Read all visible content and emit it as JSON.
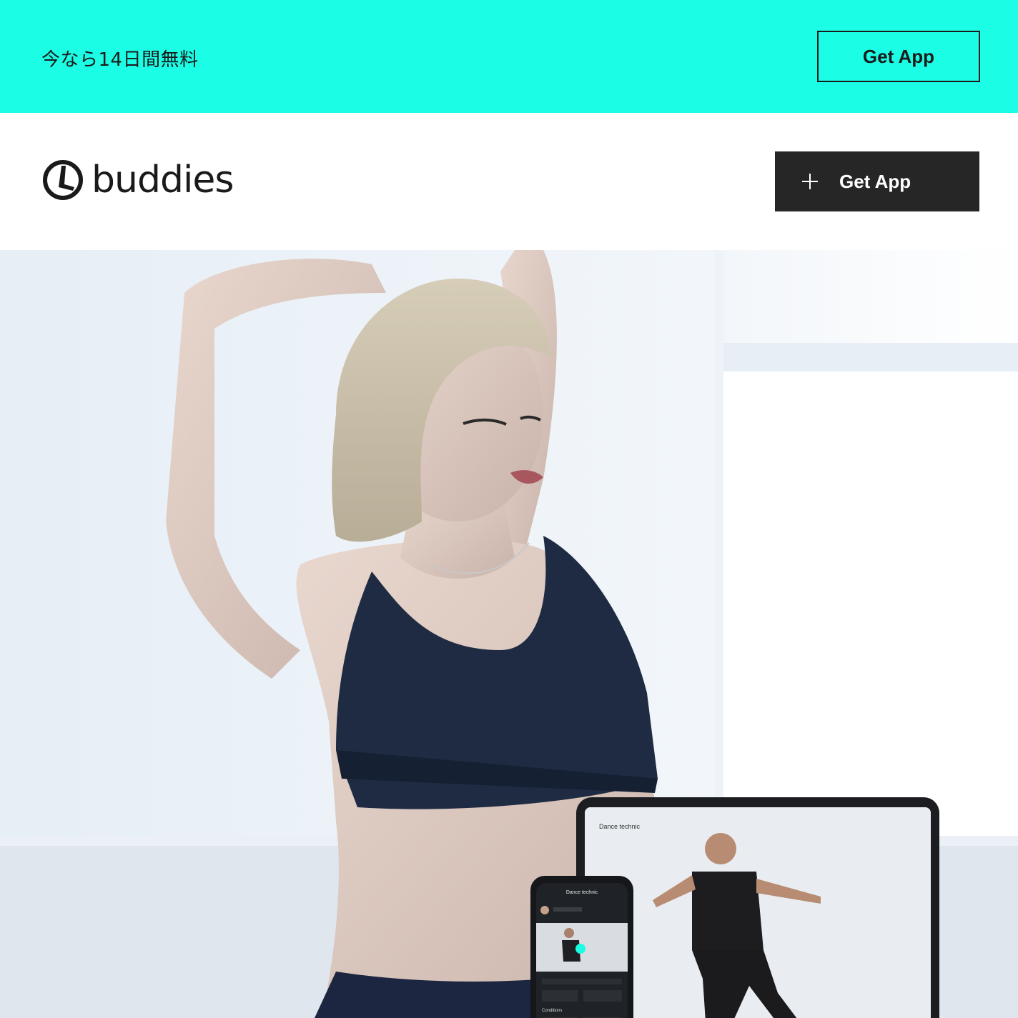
{
  "promo": {
    "text": "今なら14日間無料",
    "button_label": "Get App"
  },
  "header": {
    "logo_text": "buddies",
    "button_label": "Get App"
  },
  "hero": {
    "tablet_screen_title": "Dance technic",
    "phone_screen_title": "Dance technic",
    "phone_section_label": "Conditions"
  },
  "colors": {
    "promo_bg": "#1cfde6",
    "header_button_bg": "#262626",
    "text_dark": "#1a1a1a"
  },
  "icons": {
    "logo": "buddies-logo-icon",
    "plus": "plus-icon"
  }
}
